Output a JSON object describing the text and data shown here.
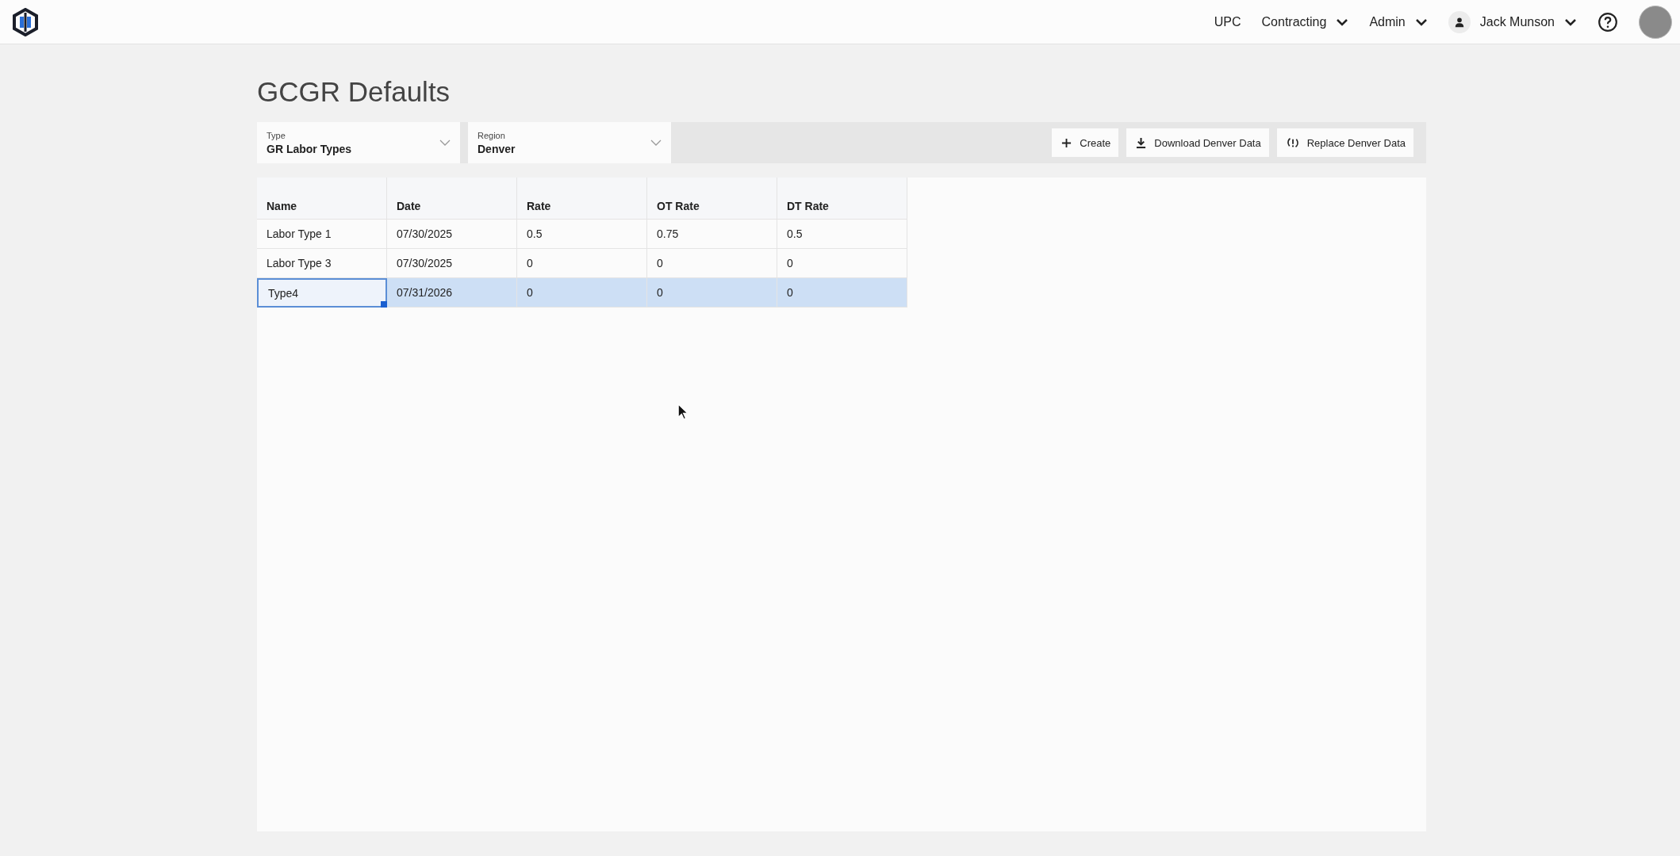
{
  "nav": {
    "links": [
      {
        "label": "UPC",
        "kind": "link"
      },
      {
        "label": "Contracting",
        "kind": "menu"
      },
      {
        "label": "Admin",
        "kind": "menu"
      }
    ],
    "user": "Jack Munson"
  },
  "title": "GCGR Defaults",
  "filters": [
    {
      "label": "Type",
      "value": "GR Labor Types"
    },
    {
      "label": "Region",
      "value": "Denver"
    }
  ],
  "actions": [
    {
      "label": "Create",
      "kind": "create"
    },
    {
      "label": "Download Denver Data",
      "kind": "download"
    },
    {
      "label": "Replace Denver Data",
      "kind": "replace"
    }
  ],
  "table": {
    "columns": [
      "Name",
      "Date",
      "Rate",
      "OT Rate",
      "DT Rate"
    ],
    "rows": [
      {
        "cells": [
          "Labor Type 1",
          "07/30/2025",
          "0.5",
          "0.75",
          "0.5"
        ],
        "selected": false,
        "focused": false
      },
      {
        "cells": [
          "Labor Type 3",
          "07/30/2025",
          "0",
          "0",
          "0"
        ],
        "selected": false,
        "focused": false
      },
      {
        "cells": [
          "Type4",
          "07/31/2026",
          "0",
          "0",
          "0"
        ],
        "selected": true,
        "focused": true
      }
    ]
  }
}
